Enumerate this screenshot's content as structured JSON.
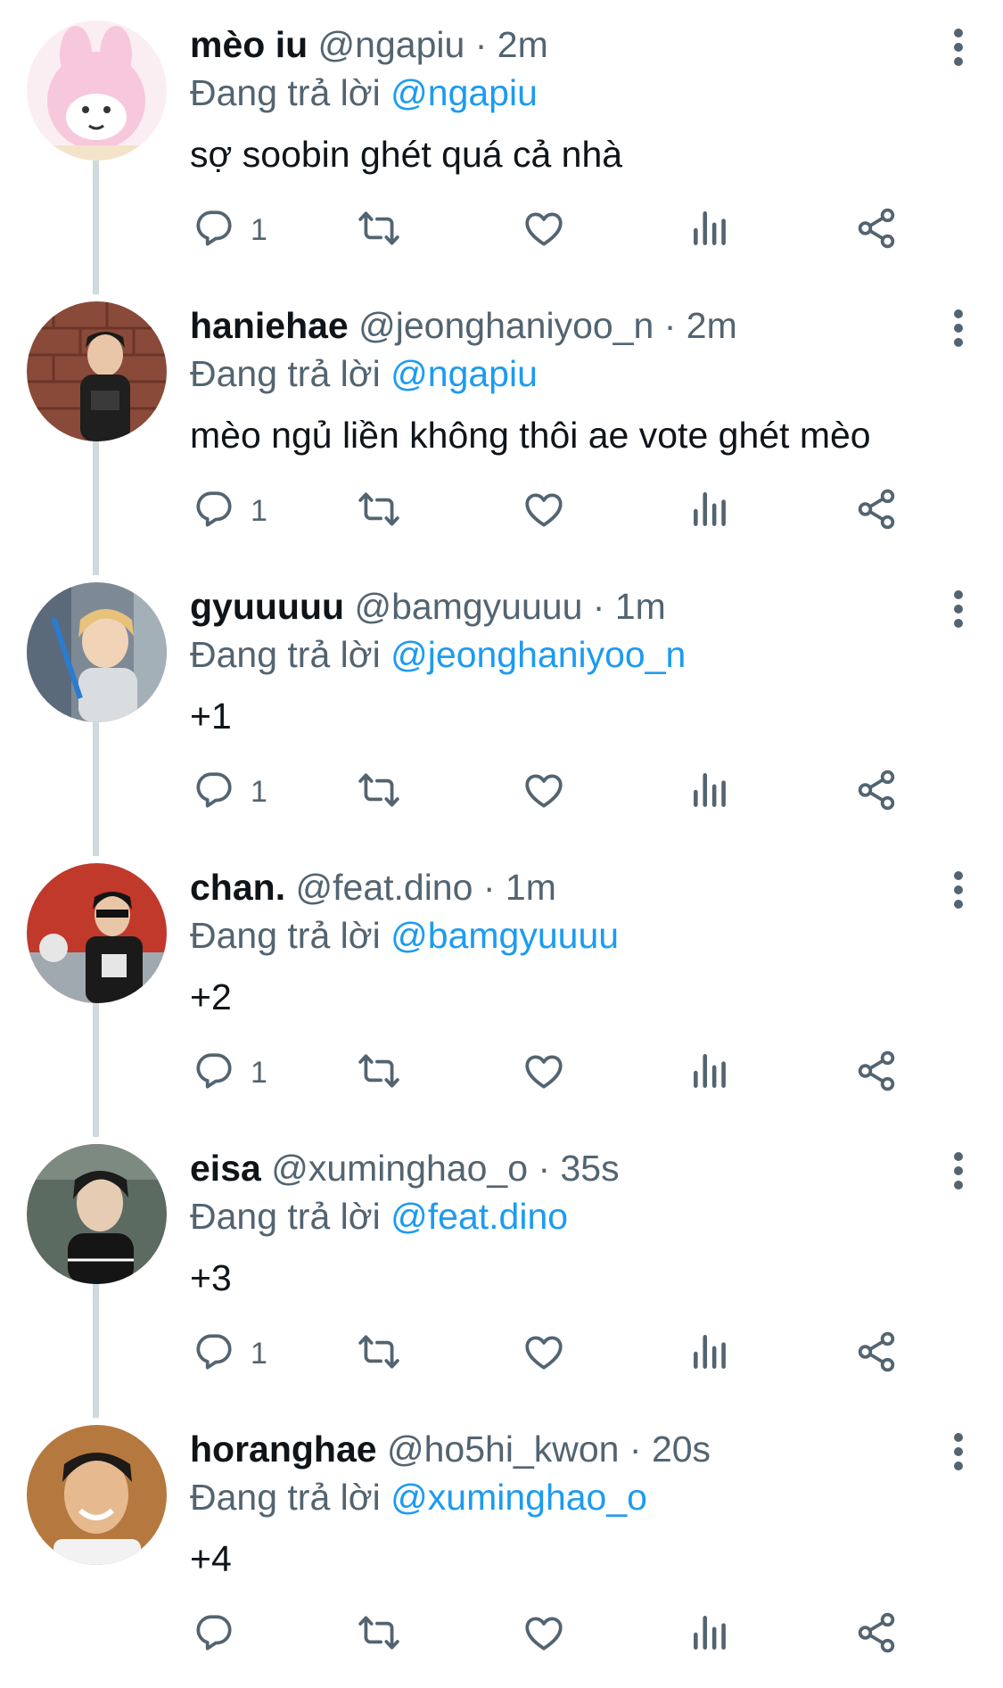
{
  "replies": [
    {
      "name": "mèo iu",
      "handle": "@ngapiu",
      "time": "2m",
      "replying_prefix": "Đang trả lời",
      "replying_to": "@ngapiu",
      "text": "sợ soobin ghét quá cả nhà",
      "reply_count": "1",
      "avatar_color": "#f7c7dc"
    },
    {
      "name": "haniehae",
      "handle": "@jeonghaniyoo_n",
      "time": "2m",
      "replying_prefix": "Đang trả lời",
      "replying_to": "@ngapiu",
      "text": "mèo ngủ liền không thôi ae vote ghét mèo",
      "reply_count": "1",
      "avatar_color": "#8a4a3a"
    },
    {
      "name": "gyuuuuu",
      "handle": "@bamgyuuuu",
      "time": "1m",
      "replying_prefix": "Đang trả lời",
      "replying_to": "@jeonghaniyoo_n",
      "text": "+1",
      "reply_count": "1",
      "avatar_color": "#e8c27a"
    },
    {
      "name": "chan.",
      "handle": "@feat.dino",
      "time": "1m",
      "replying_prefix": "Đang trả lời",
      "replying_to": "@bamgyuuuu",
      "text": "+2",
      "reply_count": "1",
      "avatar_color": "#c0392b"
    },
    {
      "name": "eisa",
      "handle": "@xuminghao_o",
      "time": "35s",
      "replying_prefix": "Đang trả lời",
      "replying_to": "@feat.dino",
      "text": "+3",
      "reply_count": "1",
      "avatar_color": "#5c6b62"
    },
    {
      "name": "horanghae",
      "handle": "@ho5hi_kwon",
      "time": "20s",
      "replying_prefix": "Đang trả lời",
      "replying_to": "@xuminghao_o",
      "text": "+4",
      "reply_count": "",
      "avatar_color": "#b5793f"
    }
  ],
  "separator": "·",
  "colors": {
    "link": "#1d9bf0",
    "secondary_text": "#536471",
    "thread_line": "#cfd9de"
  },
  "icons": [
    "reply-icon",
    "retweet-icon",
    "like-icon",
    "views-icon",
    "share-icon",
    "more-icon"
  ]
}
